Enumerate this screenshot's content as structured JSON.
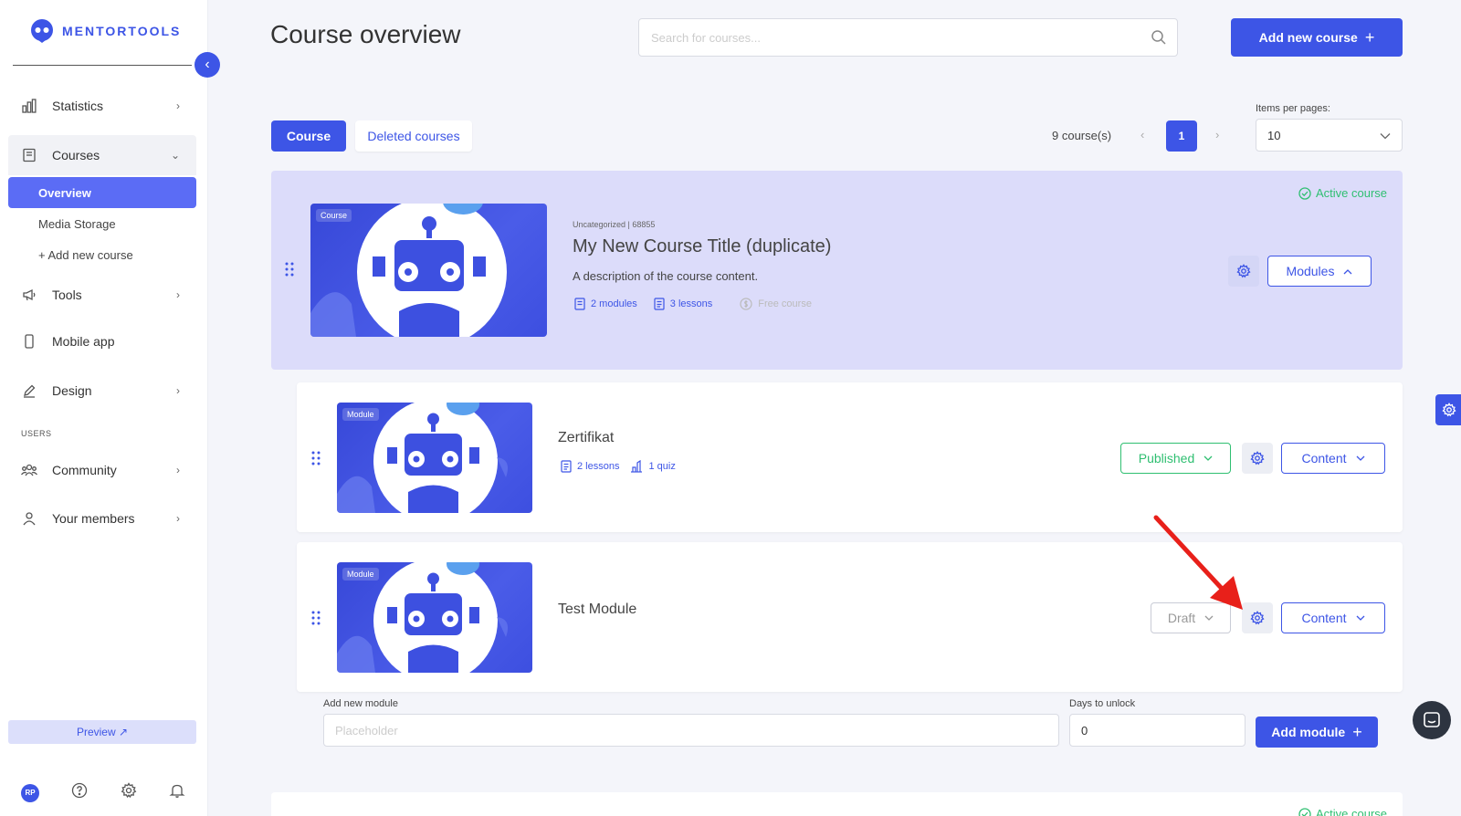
{
  "app": {
    "logo_text": "MENTORTOOLS"
  },
  "sidebar": {
    "items": [
      {
        "label": "Statistics",
        "icon": "bar-chart-icon"
      },
      {
        "label": "Courses",
        "icon": "book-icon"
      },
      {
        "label": "Tools",
        "icon": "megaphone-icon"
      },
      {
        "label": "Mobile app",
        "icon": "phone-icon"
      },
      {
        "label": "Design",
        "icon": "pencil-icon"
      },
      {
        "label": "Community",
        "icon": "people-icon"
      },
      {
        "label": "Your members",
        "icon": "user-icon"
      }
    ],
    "sub_items": [
      {
        "label": "Overview"
      },
      {
        "label": "Media Storage"
      },
      {
        "label": "+ Add new course"
      }
    ],
    "section_label": "USERS",
    "preview_label": "Preview ↗",
    "avatar_initials": "RP"
  },
  "header": {
    "title": "Course overview",
    "search_placeholder": "Search for courses...",
    "add_course_label": "Add new course"
  },
  "toolbar": {
    "tab_course": "Course",
    "tab_deleted": "Deleted courses",
    "course_count": "9 course(s)",
    "current_page": "1",
    "items_per_page_label": "Items per pages:",
    "items_per_page_value": "10"
  },
  "course": {
    "tag": "Course",
    "meta": "Uncategorized | 68855",
    "title": "My New Course Title (duplicate)",
    "description": "A description of the course content.",
    "modules_count": "2 modules",
    "lessons_count": "3 lessons",
    "price": "Free course",
    "status": "Active course",
    "modules_button": "Modules"
  },
  "modules": [
    {
      "tag": "Module",
      "title": "Zertifikat",
      "lessons": "2 lessons",
      "quiz": "1 quiz",
      "status": "Published",
      "content_button": "Content"
    },
    {
      "tag": "Module",
      "title": "Test Module",
      "status": "Draft",
      "content_button": "Content"
    }
  ],
  "add_module": {
    "name_label": "Add new module",
    "name_placeholder": "Placeholder",
    "days_label": "Days to unlock",
    "days_value": "0",
    "button_label": "Add module"
  },
  "next_course": {
    "status": "Active course"
  },
  "colors": {
    "primary": "#3d55e6",
    "success": "#2fbf71",
    "course_bg": "#dcdcfa",
    "annotation_arrow": "#e8201a"
  }
}
